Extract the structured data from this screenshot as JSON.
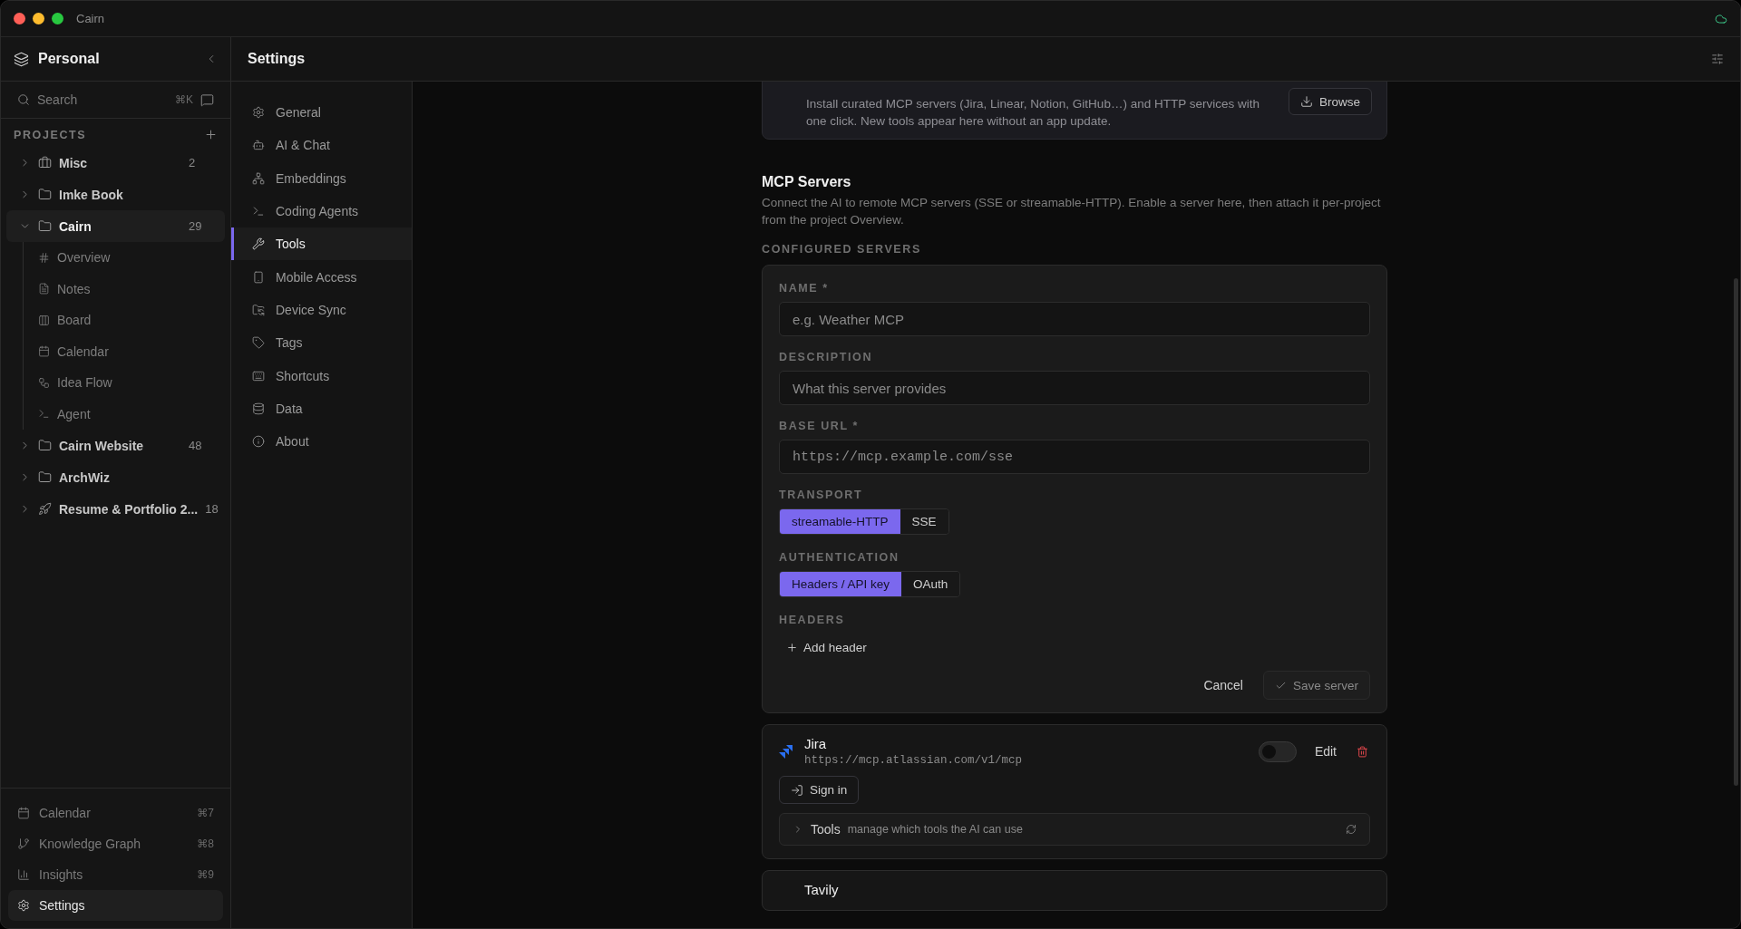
{
  "window": {
    "title": "Cairn"
  },
  "sidebar": {
    "workspace": "Personal",
    "search": {
      "placeholder": "Search",
      "shortcut": "⌘K"
    },
    "projects_heading": "PROJECTS",
    "projects": [
      {
        "name": "Misc",
        "count": "2",
        "expanded": false,
        "selected": false
      },
      {
        "name": "Imke Book",
        "expanded": false,
        "selected": false
      },
      {
        "name": "Cairn",
        "count": "29",
        "expanded": true,
        "selected": true,
        "children": [
          {
            "label": "Overview"
          },
          {
            "label": "Notes"
          },
          {
            "label": "Board"
          },
          {
            "label": "Calendar"
          },
          {
            "label": "Idea Flow"
          },
          {
            "label": "Agent"
          }
        ]
      },
      {
        "name": "Cairn Website",
        "count": "48",
        "expanded": false,
        "selected": false
      },
      {
        "name": "ArchWiz",
        "expanded": false,
        "selected": false
      },
      {
        "name": "Resume & Portfolio 2...",
        "count": "18",
        "expanded": false,
        "selected": false
      }
    ],
    "nav": [
      {
        "label": "Calendar",
        "shortcut": "⌘7",
        "selected": false
      },
      {
        "label": "Knowledge Graph",
        "shortcut": "⌘8",
        "selected": false
      },
      {
        "label": "Insights",
        "shortcut": "⌘9",
        "selected": false
      },
      {
        "label": "Settings",
        "selected": true
      }
    ]
  },
  "header": {
    "title": "Settings"
  },
  "settings_nav": [
    {
      "label": "General",
      "selected": false
    },
    {
      "label": "AI & Chat",
      "selected": false
    },
    {
      "label": "Embeddings",
      "selected": false
    },
    {
      "label": "Coding Agents",
      "selected": false
    },
    {
      "label": "Tools",
      "selected": true
    },
    {
      "label": "Mobile Access",
      "selected": false
    },
    {
      "label": "Device Sync",
      "selected": false
    },
    {
      "label": "Tags",
      "selected": false
    },
    {
      "label": "Shortcuts",
      "selected": false
    },
    {
      "label": "Data",
      "selected": false
    },
    {
      "label": "About",
      "selected": false
    }
  ],
  "catalog": {
    "description": "Install curated MCP servers (Jira, Linear, Notion, GitHub…) and HTTP services with one click. New tools appear here without an app update.",
    "button": "Browse"
  },
  "mcp": {
    "title": "MCP Servers",
    "description": "Connect the AI to remote MCP servers (SSE or streamable-HTTP). Enable a server here, then attach it per-project from the project Overview.",
    "configured_heading": "CONFIGURED SERVERS",
    "form": {
      "fields": [
        {
          "label": "NAME *",
          "placeholder": "e.g. Weather MCP",
          "kind": "text"
        },
        {
          "label": "DESCRIPTION",
          "placeholder": "What this server provides",
          "kind": "text"
        },
        {
          "label": "BASE URL *",
          "placeholder": "https://mcp.example.com/sse",
          "kind": "url"
        }
      ],
      "groups": [
        {
          "label": "TRANSPORT",
          "options": [
            {
              "label": "streamable-HTTP",
              "selected": true
            },
            {
              "label": "SSE",
              "selected": false
            }
          ]
        },
        {
          "label": "AUTHENTICATION",
          "options": [
            {
              "label": "Headers / API key",
              "selected": true
            },
            {
              "label": "OAuth",
              "selected": false
            }
          ]
        }
      ],
      "headers_label": "HEADERS",
      "add_header": "Add header",
      "cancel": "Cancel",
      "save": "Save server"
    },
    "servers": [
      {
        "name": "Jira",
        "url": "https://mcp.atlassian.com/v1/mcp",
        "enabled": false,
        "edit": "Edit",
        "sign_in": "Sign in",
        "tools_label": "Tools",
        "tools_hint": "manage which tools the AI can use"
      },
      {
        "name": "Tavily"
      }
    ]
  }
}
